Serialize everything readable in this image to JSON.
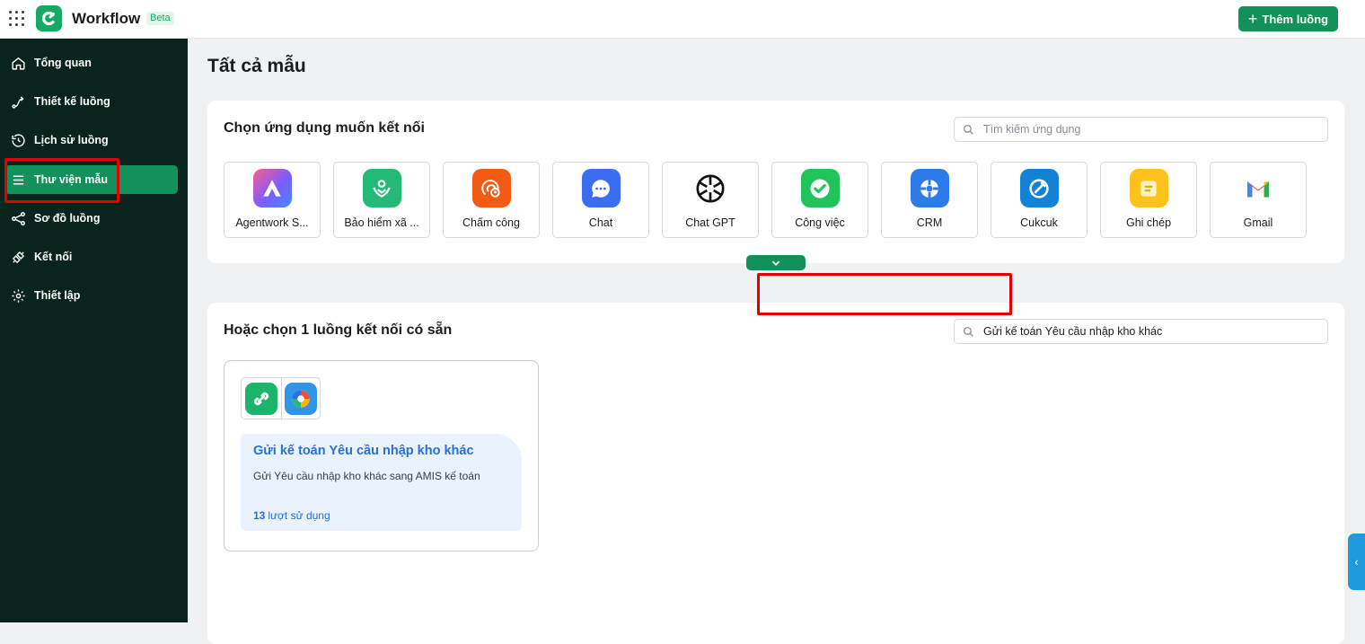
{
  "header": {
    "app_title": "Workflow",
    "badge": "Beta",
    "add_button": "Thêm luồng",
    "accent": "#12925a"
  },
  "sidebar": {
    "items": [
      {
        "label": "Tổng quan",
        "icon": "home-icon"
      },
      {
        "label": "Thiết kế luồng",
        "icon": "route-icon"
      },
      {
        "label": "Lịch sử luồng",
        "icon": "history-icon"
      },
      {
        "label": "Thư viện mẫu",
        "icon": "menu-icon",
        "active": true
      },
      {
        "label": "Sơ đồ luồng",
        "icon": "share-icon"
      },
      {
        "label": "Kết nối",
        "icon": "connect-icon"
      },
      {
        "label": "Thiết lập",
        "icon": "gear-icon"
      }
    ]
  },
  "main": {
    "page_title": "Tất cả mẫu",
    "apps_section": {
      "title": "Chọn ứng dụng muốn kết nối",
      "search_placeholder": "Tìm kiếm ứng dụng",
      "apps": [
        {
          "label": "Agentwork S...",
          "icon": "agentwork-icon"
        },
        {
          "label": "Bảo hiểm xã ...",
          "icon": "insurance-icon"
        },
        {
          "label": "Chấm công",
          "icon": "timekeeping-icon"
        },
        {
          "label": "Chat",
          "icon": "chat-icon"
        },
        {
          "label": "Chat GPT",
          "icon": "chatgpt-icon"
        },
        {
          "label": "Công việc",
          "icon": "task-icon"
        },
        {
          "label": "CRM",
          "icon": "crm-icon"
        },
        {
          "label": "Cukcuk",
          "icon": "cukcuk-icon"
        },
        {
          "label": "Ghi chép",
          "icon": "note-icon"
        },
        {
          "label": "Gmail",
          "icon": "gmail-icon"
        }
      ]
    },
    "flows_section": {
      "title": "Hoặc chọn 1 luồng kết nối có sẵn",
      "search_value": "Gửi kế toán Yêu cầu nhập kho khác",
      "flows": [
        {
          "name": "Gửi kế toán Yêu cầu nhập kho khác",
          "description": "Gửi Yêu cầu nhập kho khác sang AMIS kế toán",
          "usage_count": "13",
          "usage_label": "lượt sử dụng"
        }
      ]
    }
  }
}
